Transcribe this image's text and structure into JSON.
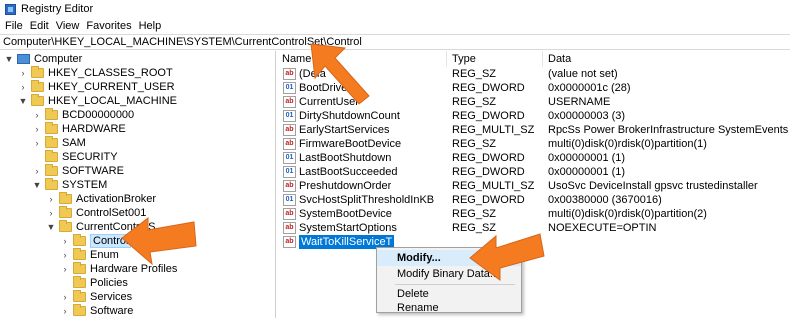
{
  "window": {
    "title": "Registry Editor"
  },
  "menu": [
    "File",
    "Edit",
    "View",
    "Favorites",
    "Help"
  ],
  "address": "Computer\\HKEY_LOCAL_MACHINE\\SYSTEM\\CurrentControlSet\\Control",
  "tree": [
    {
      "label": "Computer",
      "expander": "▼",
      "icon": "computer-icon"
    },
    {
      "label": "HKEY_CLASSES_ROOT",
      "expander": "›",
      "icon": "folder-icon"
    },
    {
      "label": "HKEY_CURRENT_USER",
      "expander": "›",
      "icon": "folder-icon"
    },
    {
      "label": "HKEY_LOCAL_MACHINE",
      "expander": "▼",
      "icon": "folder-icon"
    },
    {
      "label": "BCD00000000",
      "expander": "›",
      "icon": "folder-icon"
    },
    {
      "label": "HARDWARE",
      "expander": "›",
      "icon": "folder-icon"
    },
    {
      "label": "SAM",
      "expander": "›",
      "icon": "folder-icon"
    },
    {
      "label": "SECURITY",
      "expander": "",
      "icon": "folder-icon"
    },
    {
      "label": "SOFTWARE",
      "expander": "›",
      "icon": "folder-icon"
    },
    {
      "label": "SYSTEM",
      "expander": "▼",
      "icon": "folder-icon"
    },
    {
      "label": "ActivationBroker",
      "expander": "›",
      "icon": "folder-icon"
    },
    {
      "label": "ControlSet001",
      "expander": "›",
      "icon": "folder-icon"
    },
    {
      "label": "CurrentControlS",
      "expander": "▼",
      "icon": "folder-icon"
    },
    {
      "label": "Control",
      "expander": "›",
      "icon": "folder-icon",
      "selected": true
    },
    {
      "label": "Enum",
      "expander": "›",
      "icon": "folder-icon"
    },
    {
      "label": "Hardware Profiles",
      "expander": "›",
      "icon": "folder-icon"
    },
    {
      "label": "Policies",
      "expander": "",
      "icon": "folder-icon"
    },
    {
      "label": "Services",
      "expander": "›",
      "icon": "folder-icon"
    },
    {
      "label": "Software",
      "expander": "›",
      "icon": "folder-icon"
    }
  ],
  "columns": {
    "name": "Name",
    "type": "Type",
    "data": "Data"
  },
  "values": [
    {
      "name": "(Defa",
      "type": "REG_SZ",
      "data": "(value not set)",
      "kind": "ab"
    },
    {
      "name": "BootDrive",
      "type": "REG_DWORD",
      "data": "0x0000001c (28)",
      "kind": "bin"
    },
    {
      "name": "CurrentUser",
      "type": "REG_SZ",
      "data": "USERNAME",
      "kind": "ab"
    },
    {
      "name": "DirtyShutdownCount",
      "type": "REG_DWORD",
      "data": "0x00000003 (3)",
      "kind": "bin"
    },
    {
      "name": "EarlyStartServices",
      "type": "REG_MULTI_SZ",
      "data": "RpcSs Power BrokerInfrastructure SystemEventsBro...",
      "kind": "ab"
    },
    {
      "name": "FirmwareBootDevice",
      "type": "REG_SZ",
      "data": "multi(0)disk(0)rdisk(0)partition(1)",
      "kind": "ab"
    },
    {
      "name": "LastBootShutdown",
      "type": "REG_DWORD",
      "data": "0x00000001 (1)",
      "kind": "bin"
    },
    {
      "name": "LastBootSucceeded",
      "type": "REG_DWORD",
      "data": "0x00000001 (1)",
      "kind": "bin"
    },
    {
      "name": "PreshutdownOrder",
      "type": "REG_MULTI_SZ",
      "data": "UsoSvc DeviceInstall gpsvc trustedinstaller",
      "kind": "ab"
    },
    {
      "name": "SvcHostSplitThresholdInKB",
      "type": "REG_DWORD",
      "data": "0x00380000 (3670016)",
      "kind": "bin"
    },
    {
      "name": "SystemBootDevice",
      "type": "REG_SZ",
      "data": "multi(0)disk(0)rdisk(0)partition(2)",
      "kind": "ab"
    },
    {
      "name": "SystemStartOptions",
      "type": "REG_SZ",
      "data": " NOEXECUTE=OPTIN",
      "kind": "ab"
    },
    {
      "name": "WaitToKillServiceT",
      "type": "",
      "data": "",
      "kind": "ab",
      "highlight": true
    }
  ],
  "context_menu": {
    "modify": "Modify...",
    "modify_binary": "Modify Binary Data...",
    "delete": "Delete",
    "rename": "Rename"
  },
  "colors": {
    "arrow": "#f47b20",
    "selection": "#0078d7"
  }
}
